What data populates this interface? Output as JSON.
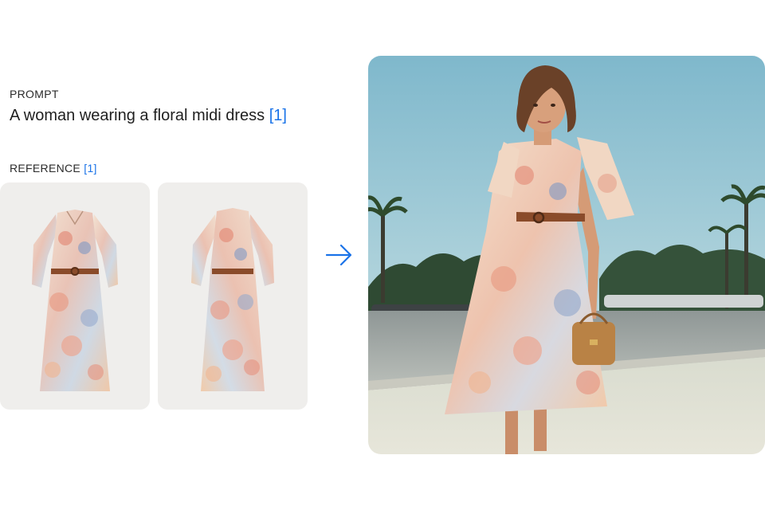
{
  "prompt": {
    "label": "PROMPT",
    "text": "A woman wearing a floral midi dress",
    "ref_tag": "[1]"
  },
  "reference": {
    "label": "REFERENCE",
    "ref_tag": "[1]",
    "images": [
      "dress-front-photo",
      "dress-back-photo"
    ]
  },
  "arrow_icon": "arrow-right-icon",
  "result_image": "woman-in-floral-dress-photo",
  "colors": {
    "accent": "#1a73e8",
    "card_bg": "#efeeec",
    "sky": "#8ec3d4",
    "belt": "#8a4b2a"
  }
}
